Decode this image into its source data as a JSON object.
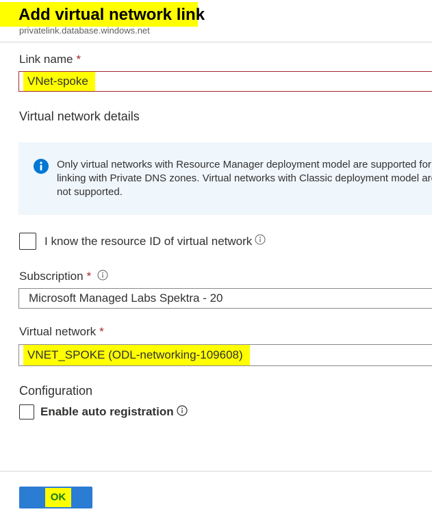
{
  "panel": {
    "title": "Add virtual network link",
    "subtitle": "privatelink.database.windows.net"
  },
  "link_name": {
    "label": "Link name",
    "required_mark": "*",
    "value": "VNet-spoke"
  },
  "virtual_network_details": {
    "heading": "Virtual network details",
    "info_message": "Only virtual networks with Resource Manager deployment model are supported for linking with Private DNS zones. Virtual networks with Classic deployment model are not supported."
  },
  "resource_id_checkbox": {
    "label": "I know the resource ID of virtual network",
    "checked": false
  },
  "subscription": {
    "label": "Subscription",
    "required_mark": "*",
    "value": "Microsoft Managed Labs Spektra - 20"
  },
  "virtual_network": {
    "label": "Virtual network",
    "required_mark": "*",
    "value": "VNET_SPOKE (ODL-networking-109608)"
  },
  "configuration": {
    "heading": "Configuration",
    "auto_registration_label": "Enable auto registration",
    "auto_registration_checked": false
  },
  "footer": {
    "ok_label": "OK"
  },
  "colors": {
    "highlight": "#ffff00",
    "required": "#a4262c",
    "info_icon": "#0078d4",
    "info_bg": "#eff6fc",
    "ok_button": "#2b7cd3",
    "ok_text": "#107c10"
  },
  "icons": {
    "info_banner": "info-circle-filled-icon",
    "tooltip": "info-circle-outline-icon"
  }
}
